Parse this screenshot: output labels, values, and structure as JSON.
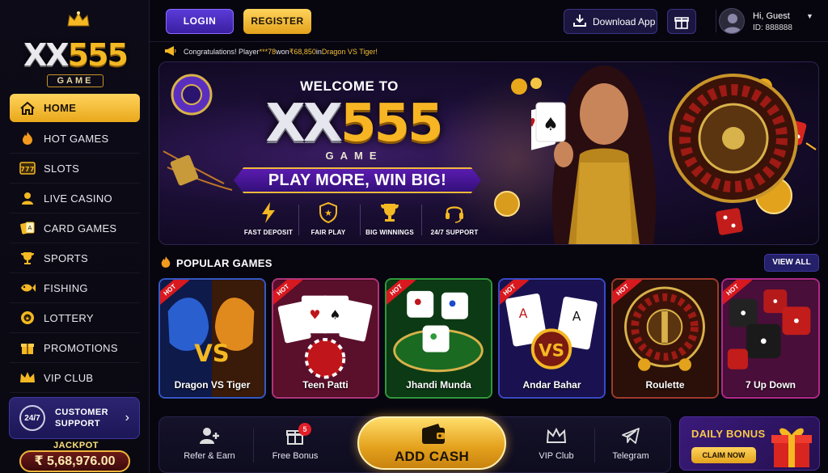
{
  "brand": {
    "logo_main_left": "XX",
    "logo_main_right": "555",
    "logo_sub": "GAME"
  },
  "nav": {
    "items": [
      {
        "label": "HOME",
        "icon": "home-icon",
        "active": true
      },
      {
        "label": "HOT GAMES",
        "icon": "flame-icon"
      },
      {
        "label": "SLOTS",
        "icon": "slot-777-icon"
      },
      {
        "label": "LIVE CASINO",
        "icon": "dealer-icon"
      },
      {
        "label": "CARD GAMES",
        "icon": "cards-icon"
      },
      {
        "label": "SPORTS",
        "icon": "trophy-icon"
      },
      {
        "label": "FISHING",
        "icon": "fish-icon"
      },
      {
        "label": "LOTTERY",
        "icon": "lottery-ball-icon"
      },
      {
        "label": "PROMOTIONS",
        "icon": "gift-icon"
      },
      {
        "label": "VIP CLUB",
        "icon": "crown-icon"
      }
    ]
  },
  "support": {
    "badge": "24/7",
    "line1": "CUSTOMER",
    "line2": "SUPPORT"
  },
  "jackpot": {
    "label": "JACKPOT",
    "amount": "₹ 5,68,976.00"
  },
  "header": {
    "login": "LOGIN",
    "register": "REGISTER",
    "download": "Download App",
    "user_greeting": "Hi, Guest",
    "user_id": "ID: 888888"
  },
  "ticker": {
    "prefix": "Congratulations! Player ",
    "player": "***78",
    "middle": " won ",
    "amount": "₹68,850",
    "mid2": " in ",
    "game": "Dragon VS Tiger!"
  },
  "hero": {
    "welcome": "WELCOME TO",
    "title_left": "XX",
    "title_right": "555",
    "subtitle": "GAME",
    "tagline": "PLAY MORE, WIN BIG!",
    "features": [
      "FAST DEPOSIT",
      "FAIR PLAY",
      "BIG WINNINGS",
      "24/7 SUPPORT"
    ]
  },
  "popular": {
    "title": "POPULAR GAMES",
    "view_all": "VIEW ALL",
    "hot_label": "HOT",
    "games": [
      "Dragon VS Tiger",
      "Teen Patti",
      "Jhandi Munda",
      "Andar Bahar",
      "Roulette",
      "7 Up Down"
    ]
  },
  "bottom": {
    "refer": "Refer & Earn",
    "bonus": "Free Bonus",
    "bonus_count": "5",
    "add_cash": "ADD CASH",
    "vip": "VIP Club",
    "telegram": "Telegram"
  },
  "daily": {
    "title": "DAILY BONUS",
    "claim": "CLAIM NOW"
  },
  "colors": {
    "gold": "#f4b823",
    "purple": "#3a1fa0",
    "bg": "#07060f",
    "hot_red": "#d8191f"
  }
}
